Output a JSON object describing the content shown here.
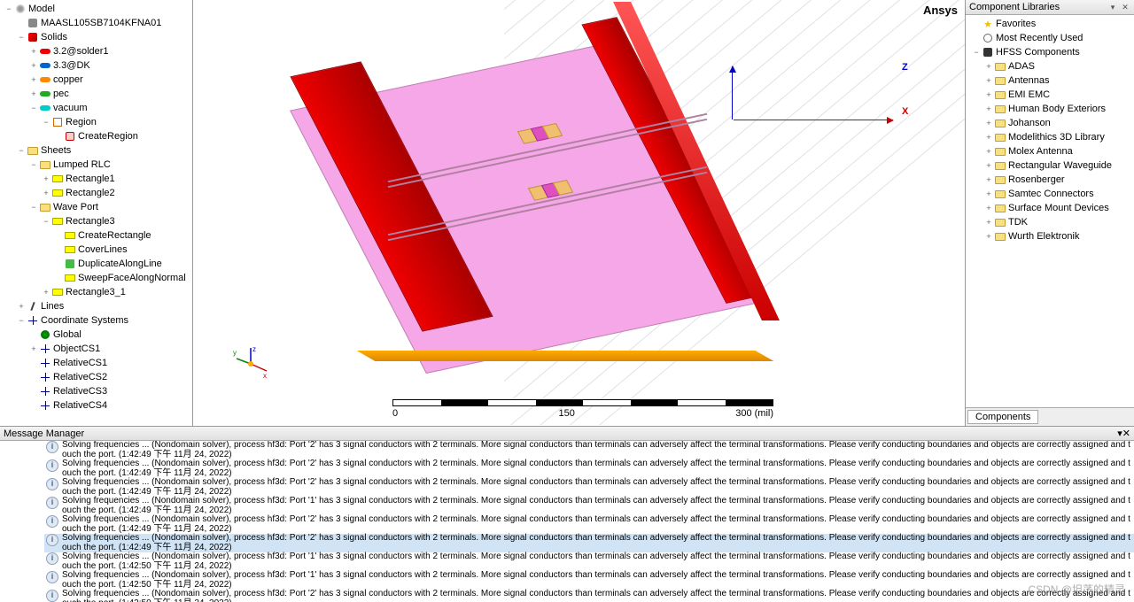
{
  "brand": "Ansys",
  "watermark": "CSDN @坦荡的精灵",
  "axes": {
    "x": "X",
    "z": "Z"
  },
  "scalebar": {
    "t0": "0",
    "t1": "150",
    "t2": "300 (mil)"
  },
  "model_tree": [
    {
      "depth": 0,
      "exp": "−",
      "icon": "ic-model",
      "label": "Model"
    },
    {
      "depth": 1,
      "exp": "",
      "icon": "ic-proj",
      "label": "MAASL105SB7104KFNA01"
    },
    {
      "depth": 1,
      "exp": "−",
      "icon": "ic-solids",
      "label": "Solids"
    },
    {
      "depth": 2,
      "exp": "+",
      "icon": "ic-mat c-red",
      "label": "3.2@solder1"
    },
    {
      "depth": 2,
      "exp": "+",
      "icon": "ic-mat c-blue",
      "label": "3.3@DK"
    },
    {
      "depth": 2,
      "exp": "+",
      "icon": "ic-mat c-orange",
      "label": "copper"
    },
    {
      "depth": 2,
      "exp": "+",
      "icon": "ic-mat c-green",
      "label": "pec"
    },
    {
      "depth": 2,
      "exp": "−",
      "icon": "ic-mat c-cyan",
      "label": "vacuum"
    },
    {
      "depth": 3,
      "exp": "−",
      "icon": "ic-region",
      "label": "Region"
    },
    {
      "depth": 4,
      "exp": "",
      "icon": "ic-cmd",
      "label": "CreateRegion"
    },
    {
      "depth": 1,
      "exp": "−",
      "icon": "ic-folder",
      "label": "Sheets"
    },
    {
      "depth": 2,
      "exp": "−",
      "icon": "ic-folder",
      "label": "Lumped RLC"
    },
    {
      "depth": 3,
      "exp": "+",
      "icon": "ic-sheet",
      "label": "Rectangle1"
    },
    {
      "depth": 3,
      "exp": "+",
      "icon": "ic-sheet",
      "label": "Rectangle2"
    },
    {
      "depth": 2,
      "exp": "−",
      "icon": "ic-folder",
      "label": "Wave Port"
    },
    {
      "depth": 3,
      "exp": "−",
      "icon": "ic-sheet",
      "label": "Rectangle3"
    },
    {
      "depth": 4,
      "exp": "",
      "icon": "ic-sheet",
      "label": "CreateRectangle"
    },
    {
      "depth": 4,
      "exp": "",
      "icon": "ic-sheet",
      "label": "CoverLines"
    },
    {
      "depth": 4,
      "exp": "",
      "icon": "ic-op",
      "label": "DuplicateAlongLine"
    },
    {
      "depth": 4,
      "exp": "",
      "icon": "ic-sheet",
      "label": "SweepFaceAlongNormal"
    },
    {
      "depth": 3,
      "exp": "+",
      "icon": "ic-sheet",
      "label": "Rectangle3_1"
    },
    {
      "depth": 1,
      "exp": "+",
      "icon": "ic-line",
      "label": "Lines"
    },
    {
      "depth": 1,
      "exp": "−",
      "icon": "ic-cs",
      "label": "Coordinate Systems"
    },
    {
      "depth": 2,
      "exp": "",
      "icon": "ic-globe",
      "label": "Global"
    },
    {
      "depth": 2,
      "exp": "+",
      "icon": "ic-cs",
      "label": "ObjectCS1"
    },
    {
      "depth": 2,
      "exp": "",
      "icon": "ic-cs",
      "label": "RelativeCS1"
    },
    {
      "depth": 2,
      "exp": "",
      "icon": "ic-cs",
      "label": "RelativeCS2"
    },
    {
      "depth": 2,
      "exp": "",
      "icon": "ic-cs",
      "label": "RelativeCS3"
    },
    {
      "depth": 2,
      "exp": "",
      "icon": "ic-cs",
      "label": "RelativeCS4"
    }
  ],
  "lib_panel": {
    "title": "Component Libraries",
    "tab": "Components",
    "items": [
      {
        "depth": 0,
        "exp": "",
        "icon": "ic-fav",
        "label": "Favorites"
      },
      {
        "depth": 0,
        "exp": "",
        "icon": "ic-clock",
        "label": "Most Recently Used"
      },
      {
        "depth": 0,
        "exp": "−",
        "icon": "ic-hfss",
        "label": "HFSS Components"
      },
      {
        "depth": 1,
        "exp": "+",
        "icon": "ic-libfolder",
        "label": "ADAS"
      },
      {
        "depth": 1,
        "exp": "+",
        "icon": "ic-libfolder",
        "label": "Antennas"
      },
      {
        "depth": 1,
        "exp": "+",
        "icon": "ic-libfolder",
        "label": "EMI EMC"
      },
      {
        "depth": 1,
        "exp": "+",
        "icon": "ic-libfolder",
        "label": "Human Body Exteriors"
      },
      {
        "depth": 1,
        "exp": "+",
        "icon": "ic-libfolder",
        "label": "Johanson"
      },
      {
        "depth": 1,
        "exp": "+",
        "icon": "ic-libfolder",
        "label": "Modelithics 3D Library"
      },
      {
        "depth": 1,
        "exp": "+",
        "icon": "ic-libfolder",
        "label": "Molex Antenna"
      },
      {
        "depth": 1,
        "exp": "+",
        "icon": "ic-libfolder",
        "label": "Rectangular Waveguide"
      },
      {
        "depth": 1,
        "exp": "+",
        "icon": "ic-libfolder",
        "label": "Rosenberger"
      },
      {
        "depth": 1,
        "exp": "+",
        "icon": "ic-libfolder",
        "label": "Samtec Connectors"
      },
      {
        "depth": 1,
        "exp": "+",
        "icon": "ic-libfolder",
        "label": "Surface Mount Devices"
      },
      {
        "depth": 1,
        "exp": "+",
        "icon": "ic-libfolder",
        "label": "TDK"
      },
      {
        "depth": 1,
        "exp": "+",
        "icon": "ic-libfolder",
        "label": "Wurth Elektronik"
      }
    ]
  },
  "msg_panel": {
    "title": "Message Manager",
    "messages": [
      {
        "port": "2",
        "ts": "1:42:49 下午  11月 24, 2022",
        "sel": false
      },
      {
        "port": "2",
        "ts": "1:42:49 下午  11月 24, 2022",
        "sel": false
      },
      {
        "port": "2",
        "ts": "1:42:49 下午  11月 24, 2022",
        "sel": false
      },
      {
        "port": "1",
        "ts": "1:42:49 下午  11月 24, 2022",
        "sel": false
      },
      {
        "port": "2",
        "ts": "1:42:49 下午  11月 24, 2022",
        "sel": false
      },
      {
        "port": "2",
        "ts": "1:42:49 下午  11月 24, 2022",
        "sel": true
      },
      {
        "port": "1",
        "ts": "1:42:50 下午  11月 24, 2022",
        "sel": false
      },
      {
        "port": "1",
        "ts": "1:42:50 下午  11月 24, 2022",
        "sel": false
      },
      {
        "port": "2",
        "ts": "1:42:50 下午  11月 24, 2022",
        "sel": false
      }
    ],
    "template_a": "Solving frequencies ... (Nondomain solver), process hf3d: Port '",
    "template_b": "' has 3 signal conductors with 2 terminals. More signal conductors than terminals can adversely affect the terminal transformations. Please verify conducting boundaries and objects are correctly assigned and touch the port. (",
    "template_c": ")"
  }
}
